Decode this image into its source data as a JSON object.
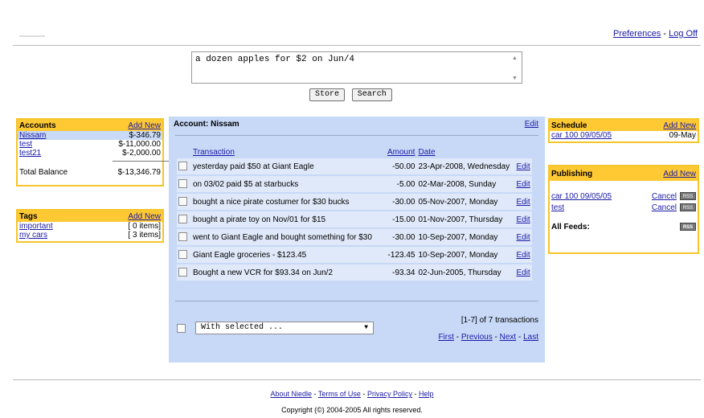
{
  "header": {
    "preferences": "Preferences",
    "separator": "-",
    "logoff": "Log Off"
  },
  "entry": {
    "value": "a dozen apples for $2 on Jun/4",
    "store": "Store",
    "search": "Search"
  },
  "accounts": {
    "title": "Accounts",
    "add_new": "Add New",
    "items": [
      {
        "name": "Nissam",
        "amount": "$-346.79"
      },
      {
        "name": "test",
        "amount": "$-11,000.00"
      },
      {
        "name": "test21",
        "amount": "$-2,000.00"
      }
    ],
    "total_label": "Total Balance",
    "total_amount": "$-13,346.79"
  },
  "tags": {
    "title": "Tags",
    "add_new": "Add New",
    "items": [
      {
        "name": "important",
        "count": "[ 0 items]"
      },
      {
        "name": "my cars",
        "count": "[ 3 items]"
      }
    ]
  },
  "main": {
    "title": "Account: Nissam",
    "edit": "Edit",
    "columns": {
      "transaction": "Transaction",
      "amount": "Amount",
      "date": "Date"
    },
    "rows": [
      {
        "desc": "yesterday paid $50 at Giant Eagle",
        "amount": "-50.00",
        "date": "23-Apr-2008, Wednesday",
        "edit": "Edit"
      },
      {
        "desc": "on 03/02 paid $5 at starbucks",
        "amount": "-5.00",
        "date": "02-Mar-2008, Sunday",
        "edit": "Edit"
      },
      {
        "desc": "bought a nice pirate costumer for $30 bucks",
        "amount": "-30.00",
        "date": "05-Nov-2007, Monday",
        "edit": "Edit"
      },
      {
        "desc": "bought a pirate toy on Nov/01 for $15",
        "amount": "-15.00",
        "date": "01-Nov-2007, Thursday",
        "edit": "Edit"
      },
      {
        "desc": "went to Giant Eagle and bought something for $30",
        "amount": "-30.00",
        "date": "10-Sep-2007, Monday",
        "edit": "Edit"
      },
      {
        "desc": "Giant Eagle groceries - $123.45",
        "amount": "-123.45",
        "date": "10-Sep-2007, Monday",
        "edit": "Edit"
      },
      {
        "desc": "Bought a new VCR for $93.34 on Jun/2",
        "amount": "-93.34",
        "date": "02-Jun-2005, Thursday",
        "edit": "Edit"
      }
    ],
    "with_selected": "With selected ...",
    "count": "[1-7] of 7 transactions",
    "first": "First",
    "previous": "Previous",
    "next": "Next",
    "last": "Last",
    "sep": "-"
  },
  "schedule": {
    "title": "Schedule",
    "add_new": "Add New",
    "items": [
      {
        "name": "car 100 09/05/05",
        "date": "09-May"
      }
    ]
  },
  "publishing": {
    "title": "Publishing",
    "add_new": "Add New",
    "items": [
      {
        "name": "car 100 09/05/05",
        "cancel": "Cancel",
        "rss": "RSS"
      },
      {
        "name": "test",
        "cancel": "Cancel",
        "rss": "RSS"
      }
    ],
    "all_feeds": "All Feeds:",
    "rss": "RSS"
  },
  "footer": {
    "about": "About Niedle",
    "terms": "Terms of Use",
    "privacy": "Privacy Policy",
    "help": "Help",
    "sep": "-",
    "copyright": "Copyright (©) 2004-2005 All rights reserved."
  }
}
